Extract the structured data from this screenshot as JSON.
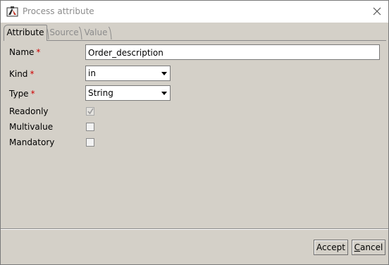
{
  "window": {
    "title": "Process attribute"
  },
  "tabs": [
    {
      "label": "Attribute",
      "active": true
    },
    {
      "label": "Source",
      "active": false
    },
    {
      "label": "Value",
      "active": false
    }
  ],
  "form": {
    "name_label": "Name",
    "name_value": "Order_description",
    "kind_label": "Kind",
    "kind_value": "in",
    "type_label": "Type",
    "type_value": "String",
    "required_mark": "*",
    "readonly_label": "Readonly",
    "readonly_checked": true,
    "multivalue_label": "Multivalue",
    "multivalue_checked": false,
    "mandatory_label": "Mandatory",
    "mandatory_checked": false
  },
  "footer": {
    "accept_label": "Accept",
    "cancel_first": "C",
    "cancel_rest": "ancel"
  },
  "icons": {
    "app": "process-app-icon",
    "close": "close-icon",
    "dropdown": "chevron-down-icon",
    "check": "checkmark-icon"
  },
  "colors": {
    "window_bg": "#d4d0c8",
    "required": "#d00000",
    "disabled_text": "#8c8c8c"
  }
}
